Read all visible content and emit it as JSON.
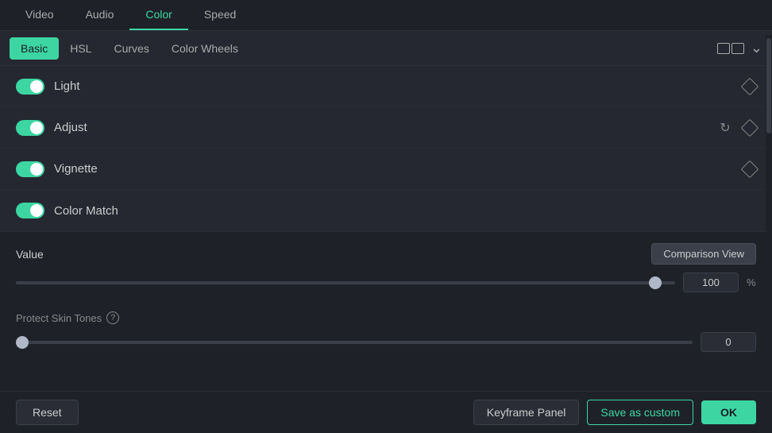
{
  "topTabs": {
    "tabs": [
      {
        "id": "video",
        "label": "Video",
        "active": false
      },
      {
        "id": "audio",
        "label": "Audio",
        "active": false
      },
      {
        "id": "color",
        "label": "Color",
        "active": true
      },
      {
        "id": "speed",
        "label": "Speed",
        "active": false
      }
    ]
  },
  "subTabs": {
    "tabs": [
      {
        "id": "basic",
        "label": "Basic",
        "active": true
      },
      {
        "id": "hsl",
        "label": "HSL",
        "active": false
      },
      {
        "id": "curves",
        "label": "Curves",
        "active": false
      },
      {
        "id": "color-wheels",
        "label": "Color Wheels",
        "active": false
      }
    ]
  },
  "sections": [
    {
      "id": "light",
      "label": "Light",
      "toggled": true,
      "hasReset": false,
      "hasDiamond": true
    },
    {
      "id": "adjust",
      "label": "Adjust",
      "toggled": true,
      "hasReset": true,
      "hasDiamond": true
    },
    {
      "id": "vignette",
      "label": "Vignette",
      "toggled": true,
      "hasReset": false,
      "hasDiamond": true
    },
    {
      "id": "color-match",
      "label": "Color Match",
      "toggled": true,
      "hasReset": false,
      "hasDiamond": false
    }
  ],
  "colorMatch": {
    "label": "Color Match"
  },
  "valueSection": {
    "label": "Value",
    "comparisonViewLabel": "Comparison View",
    "sliderValue": 100,
    "sliderPercent": "%",
    "sliderMax": 100,
    "sliderPosition": 97
  },
  "protectSkinTones": {
    "label": "Protect Skin Tones",
    "helpTooltip": "?",
    "sliderValue": 0,
    "sliderPosition": 0
  },
  "bottomBar": {
    "resetLabel": "Reset",
    "keyframePanelLabel": "Keyframe Panel",
    "saveAsCustomLabel": "Save as custom",
    "okLabel": "OK"
  }
}
